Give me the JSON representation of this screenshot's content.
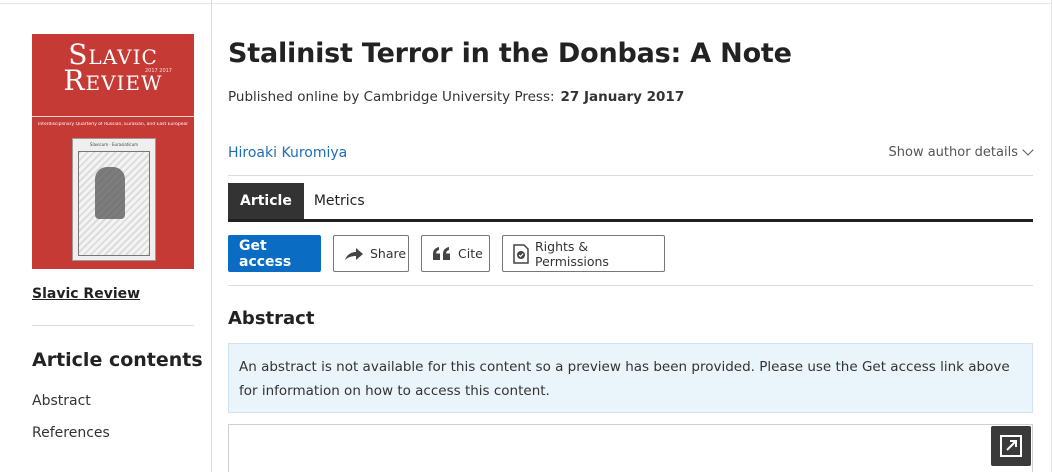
{
  "journal": {
    "cover": {
      "title_line1": "Slavic",
      "title_line2": "Review",
      "subtitle": "Interdisciplinary Quarterly of Russian, Eurasian, and East European Studies",
      "issue": "2017 2017",
      "art_caption": "Slavicum · Eurasiaticum",
      "brand_color": "#c63a35"
    },
    "link_label": "Slavic Review"
  },
  "article": {
    "title": "Stalinist Terror in the Donbas: A Note",
    "published_prefix": "Published online by Cambridge University Press:",
    "published_date": "27 January 2017",
    "author": "Hiroaki Kuromiya",
    "author_toggle": "Show author details"
  },
  "tabs": [
    {
      "label": "Article",
      "active": true
    },
    {
      "label": "Metrics",
      "active": false
    }
  ],
  "actions": {
    "get_access": "Get access",
    "share": "Share",
    "cite": "Cite",
    "rights": "Rights & Permissions"
  },
  "sidebar": {
    "contents_heading": "Article contents",
    "items": [
      "Abstract",
      "References"
    ]
  },
  "abstract": {
    "heading": "Abstract",
    "notice": "An abstract is not available for this content so a preview has been provided. Please use the Get access link above for information on how to access this content."
  },
  "colors": {
    "accent": "#0a6cc2",
    "link": "#1f6db5",
    "notice_bg": "#eaf4fb",
    "tab_active_bg": "#333333"
  },
  "icons": {
    "share": "share-arrow-icon",
    "cite": "quote-icon",
    "rights": "document-badge-icon",
    "expand": "expand-icon",
    "chevron": "chevron-down-icon"
  }
}
